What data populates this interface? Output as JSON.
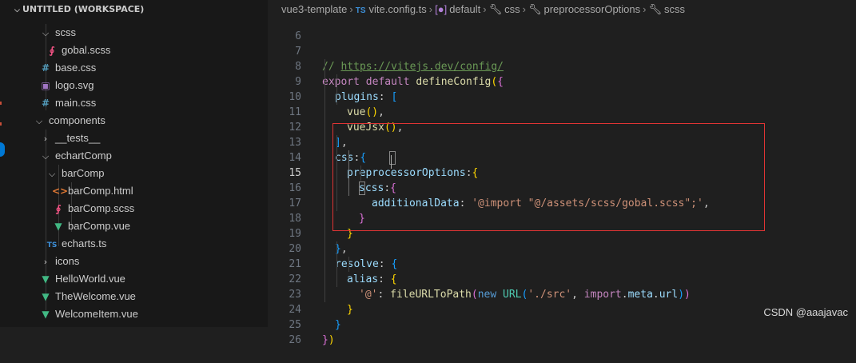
{
  "workspace": {
    "title": "UNTITLED (WORKSPACE)"
  },
  "explorer": {
    "items": [
      {
        "label": "scss",
        "icon": "chevron-down-icon"
      },
      {
        "label": "gobal.scss",
        "icon": "scss-file-icon"
      },
      {
        "label": "base.css",
        "icon": "css-file-icon"
      },
      {
        "label": "logo.svg",
        "icon": "svg-file-icon"
      },
      {
        "label": "main.css",
        "icon": "css-file-icon"
      },
      {
        "label": "components",
        "icon": "chevron-down-icon"
      },
      {
        "label": "__tests__",
        "icon": "chevron-right-icon"
      },
      {
        "label": "echartComp",
        "icon": "chevron-down-icon"
      },
      {
        "label": "barComp",
        "icon": "chevron-down-icon"
      },
      {
        "label": "barComp.html",
        "icon": "html-file-icon"
      },
      {
        "label": "barComp.scss",
        "icon": "scss-file-icon"
      },
      {
        "label": "barComp.vue",
        "icon": "vue-file-icon"
      },
      {
        "label": "echarts.ts",
        "icon": "ts-file-icon"
      },
      {
        "label": "icons",
        "icon": "chevron-right-icon"
      },
      {
        "label": "HelloWorld.vue",
        "icon": "vue-file-icon"
      },
      {
        "label": "TheWelcome.vue",
        "icon": "vue-file-icon"
      },
      {
        "label": "WelcomeItem.vue",
        "icon": "vue-file-icon"
      }
    ]
  },
  "breadcrumbs": {
    "project": "vue3-template",
    "file_badge": "TS",
    "file": "vite.config.ts",
    "export": "default",
    "css": "css",
    "preprocessor": "preprocessorOptions",
    "scss": "scss"
  },
  "editor": {
    "active_line": "15",
    "lines": [
      {
        "n": "6"
      },
      {
        "n": "7",
        "t": [
          "// ",
          "https://vitejs.dev/config/"
        ]
      },
      {
        "n": "8",
        "t": [
          "export",
          " ",
          "default",
          " ",
          "defineConfig",
          "(",
          "{"
        ]
      },
      {
        "n": "9",
        "t": [
          "plugins",
          ": ",
          "["
        ]
      },
      {
        "n": "10",
        "t": [
          "vue",
          "()",
          ","
        ]
      },
      {
        "n": "11",
        "t": [
          "vueJsx",
          "()",
          ","
        ]
      },
      {
        "n": "12",
        "t": [
          "]",
          ","
        ]
      },
      {
        "n": "13",
        "t": [
          "css",
          ":",
          "{"
        ]
      },
      {
        "n": "14",
        "t": [
          "preprocessorOptions",
          ":",
          "{"
        ]
      },
      {
        "n": "15",
        "t": [
          "scss",
          ":",
          "{"
        ]
      },
      {
        "n": "16",
        "t": [
          "additionalData",
          ": ",
          "'@import \"@/assets/scss/gobal.scss\";'",
          ","
        ]
      },
      {
        "n": "17",
        "t": [
          "}"
        ]
      },
      {
        "n": "18",
        "t": [
          "}"
        ]
      },
      {
        "n": "19",
        "t": [
          "}",
          ","
        ]
      },
      {
        "n": "20",
        "t": [
          "resolve",
          ": ",
          "{"
        ]
      },
      {
        "n": "21",
        "t": [
          "alias",
          ": ",
          "{"
        ]
      },
      {
        "n": "22",
        "t": [
          "'@'",
          ": ",
          "fileURLToPath",
          "(",
          "new",
          " ",
          "URL",
          "(",
          "'./src'",
          ", ",
          "import",
          ".",
          "meta",
          ".",
          "url",
          ")",
          ")"
        ]
      },
      {
        "n": "23",
        "t": [
          "}"
        ]
      },
      {
        "n": "24",
        "t": [
          "}"
        ]
      },
      {
        "n": "25",
        "t": [
          "}",
          ")"
        ]
      },
      {
        "n": "26"
      }
    ]
  },
  "watermark": "CSDN @aaajavac",
  "colors": {
    "background": "#1f1f1f",
    "sidebar": "#181818",
    "highlight_box": "#e03434",
    "vue_icon": "#41b883",
    "css_icon": "#519aba",
    "scss_icon": "#f55385",
    "ts_badge": "#3d8fd8",
    "svg_icon": "#a074c4",
    "html_icon": "#e37933"
  }
}
